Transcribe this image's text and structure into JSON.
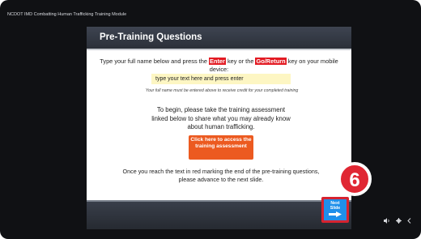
{
  "module": {
    "title": "NCDOT IMD Combatting Human Trafficking Training Module"
  },
  "slide": {
    "title": "Pre-Training Questions",
    "instruction": {
      "part1": "Type your full name below and press the ",
      "key1": "Enter",
      "part2": " key or the ",
      "key2": "Go/Return",
      "part3": " key on your mobile device:"
    },
    "name_input": {
      "value": "type your text here and press enter"
    },
    "note": "Your full name must be entered above to receive credit for your completed training",
    "begin_text": "To begin, please take the training assessment linked below to share what you may already know about human trafficking.",
    "access_button": {
      "label": "Click here to access the training assessment"
    },
    "reach_text": "Once you reach the text in red marking the end of the pre-training questions, please advance to the next slide."
  },
  "annotation": {
    "step_number": "6"
  },
  "next_button": {
    "label_line1": "Next",
    "label_line2": "Slide"
  },
  "controls": {
    "volume_icon": "volume-icon",
    "settings_icon": "gear-icon",
    "collapse_icon": "chevron-left-icon"
  },
  "colors": {
    "highlight": "#e31b23",
    "button_orange": "#ec5a20",
    "next_blue": "#1f8fea",
    "badge_red": "#d62330"
  }
}
